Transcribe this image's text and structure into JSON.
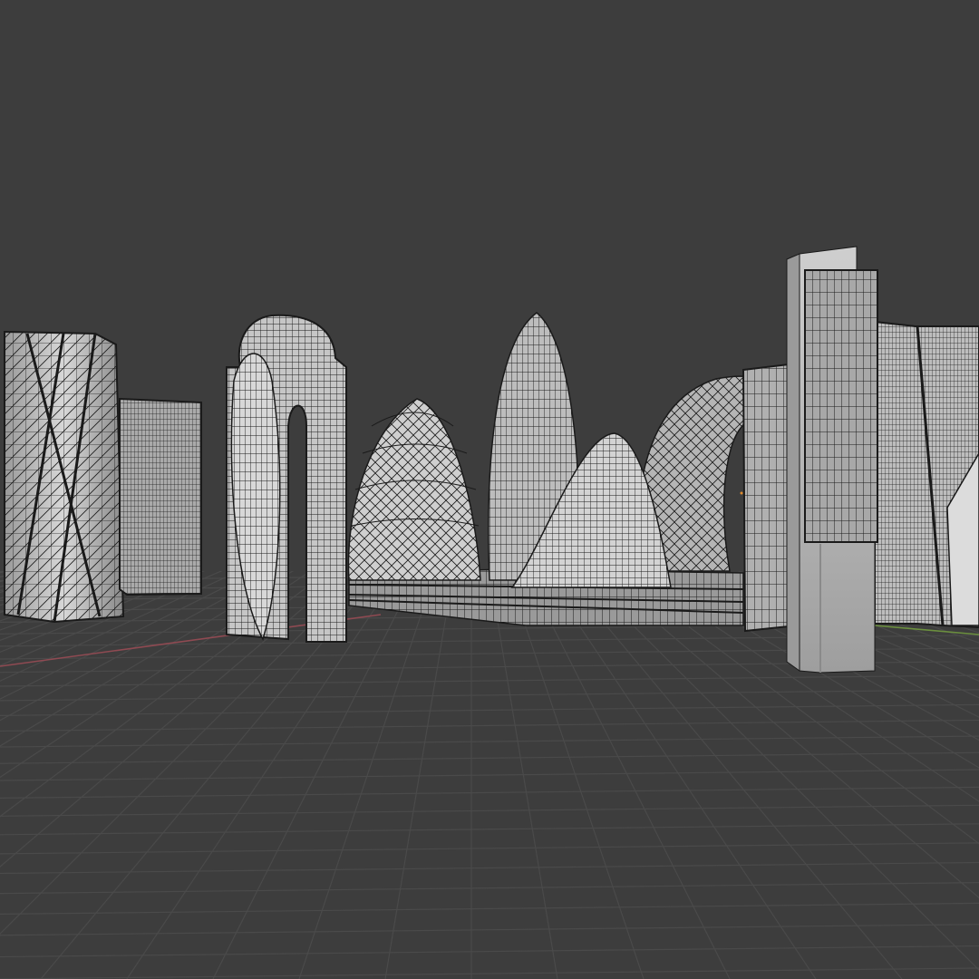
{
  "viewport": {
    "view": "3d-viewport",
    "shading": "wireframe-overlay",
    "colors": {
      "background": "#3d3d3d",
      "floor_grid": "#4a4a4a",
      "axis_x": "#8f4a52",
      "axis_y": "#6b8f3e",
      "mesh_fill": "#b9b9b9",
      "mesh_light": "#d9d9d9",
      "mesh_dark": "#7a7a7a",
      "wire": "#1a1a1a"
    }
  },
  "objects": [
    {
      "name": "twisted-tower",
      "kind": "tower"
    },
    {
      "name": "slab-tower-small",
      "kind": "tower"
    },
    {
      "name": "arch-tower",
      "kind": "tower"
    },
    {
      "name": "egg-dome",
      "kind": "dome"
    },
    {
      "name": "tall-dome",
      "kind": "dome"
    },
    {
      "name": "cone-dome",
      "kind": "dome"
    },
    {
      "name": "lattice-arch",
      "kind": "arch"
    },
    {
      "name": "podium-base",
      "kind": "base"
    },
    {
      "name": "slim-tower",
      "kind": "tower"
    },
    {
      "name": "cross-tower-selected",
      "kind": "tower"
    },
    {
      "name": "leaning-tower",
      "kind": "tower"
    }
  ]
}
